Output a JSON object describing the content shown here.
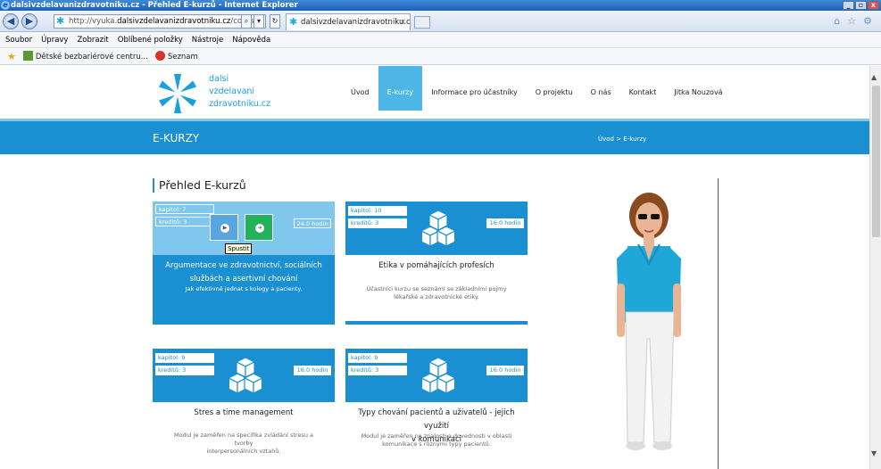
{
  "window": {
    "title": "dalsivzdelavanizdravotniku.cz - Přehled E-kurzů - Internet Explorer",
    "min": "_",
    "max": "▫",
    "close": "x"
  },
  "browser": {
    "address_prefix": "http://vyuka.",
    "address_domain": "dalsivzdelavanizdravotniku.cz",
    "address_path": "/courses",
    "tab_title": "dalsivzdelavanizdravotniku.c...",
    "tab_close": "×",
    "back_icon": "◀",
    "forward_icon": "▶",
    "refresh_icon": "↻",
    "search_icon": "⌕",
    "menu": [
      "Soubor",
      "Úpravy",
      "Zobrazit",
      "Oblíbené položky",
      "Nástroje",
      "Nápověda"
    ],
    "favorites": [
      "Dětské bezbariérové centru...",
      "Seznam"
    ]
  },
  "site": {
    "logo_lines": [
      "dalsi",
      "vzdelavani",
      "zdravotniku.cz"
    ],
    "nav": [
      "Úvod",
      "E-kurzy",
      "Informace pro účastníky",
      "O projektu",
      "O nás",
      "Kontakt",
      "Jitka Nouzová"
    ],
    "active_nav": "E-kurzy",
    "banner_title": "E-KURZY",
    "breadcrumb": "Úvod > E-kurzy",
    "section_title": "Přehled E-kurzů"
  },
  "courses": [
    {
      "chapters": "kapitol: 7",
      "credits": "kreditů: 3",
      "hours": "24.0 hodin",
      "title_lines": [
        "Argumentace ve zdravotnictví, sociálních",
        "službách a asertivní chování"
      ],
      "desc_lines": [
        "Jak efektivně jednat s kolegy a pacienty."
      ],
      "tooltip": "Spustit"
    },
    {
      "chapters": "kapitol: 10",
      "credits": "kreditů: 3",
      "hours": "16.0 hodin",
      "title_lines": [
        "Etika v pomáhajících profesích"
      ],
      "desc_lines": [
        "Účastníci kurzu se seznámí se základními pojmy",
        "lékařské a zdravotnické etiky."
      ]
    },
    {
      "chapters": "kapitol: 9",
      "credits": "kreditů: 3",
      "hours": "16.0 hodin",
      "title_lines": [
        "Stres a time management"
      ],
      "desc_lines": [
        "Modul je zaměřen na specifika zvládání stresu a tvorby",
        "interpersonálních vztahů."
      ]
    },
    {
      "chapters": "kapitol: 9",
      "credits": "kreditů: 3",
      "hours": "16.0 hodin",
      "title_lines": [
        "Typy chování pacientů a uživatelů - jejich využití",
        "v komunikaci"
      ],
      "desc_lines": [
        "Modul je zaměřen na znalosti a dovednosti v oblasti",
        "komunikace s různými typy pacientů."
      ]
    }
  ],
  "colors": {
    "brand": "#1a8fd1",
    "nav_active": "#4eb6e6",
    "play": "#59a5e0",
    "go": "#22b35a"
  }
}
